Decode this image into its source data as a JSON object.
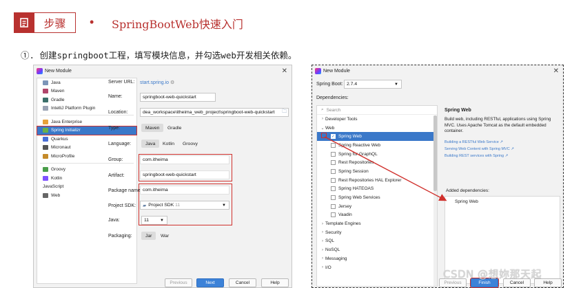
{
  "header": {
    "step_label": "步骤",
    "bullet": "•",
    "title": "SpringBootWeb快速入门",
    "accent_color": "#b8312f"
  },
  "instruction": "①. 创建springboot工程，填写模块信息，并勾选web开发相关依赖。",
  "left_dialog": {
    "title": "New Module",
    "generators": [
      {
        "label": "Java",
        "icon": "folder-icon",
        "color": "#7c95b8"
      },
      {
        "label": "Maven",
        "icon": "maven-icon",
        "color": "#b0466b"
      },
      {
        "label": "Gradle",
        "icon": "gradle-icon",
        "color": "#3b6f6a"
      },
      {
        "label": "IntelliJ Platform Plugin",
        "icon": "plugin-icon",
        "color": "#9aa3b4"
      },
      {
        "label": "Java Enterprise",
        "icon": "enterprise-icon",
        "color": "#e8a13a"
      },
      {
        "label": "Spring Initializr",
        "icon": "spring-icon",
        "color": "#6ab04c",
        "selected": true
      },
      {
        "label": "Quarkus",
        "icon": "quarkus-icon",
        "color": "#4a6fd8"
      },
      {
        "label": "Micronaut",
        "icon": "micronaut-icon",
        "color": "#555555"
      },
      {
        "label": "MicroProfile",
        "icon": "microprofile-icon",
        "color": "#c58b2a"
      },
      {
        "label": "Groovy",
        "icon": "groovy-icon",
        "color": "#4a9e4a"
      },
      {
        "label": "Kotlin",
        "icon": "kotlin-icon",
        "color": "#7f52ff"
      },
      {
        "label": "JavaScript",
        "icon": "",
        "color": ""
      },
      {
        "label": "Web",
        "icon": "globe-icon",
        "color": "#666666"
      }
    ],
    "server_url_label": "Server URL:",
    "server_url": "start.spring.io",
    "name_label": "Name:",
    "name_value": "springboot-web-quickstart",
    "location_label": "Location:",
    "location_value": "dea_workspace\\itheima_web_project\\springboot-web-quickstart",
    "type_label": "Type:",
    "type_options": [
      "Maven",
      "Gradle"
    ],
    "language_label": "Language:",
    "language_options": [
      "Java",
      "Kotlin",
      "Groovy"
    ],
    "group_label": "Group:",
    "group_value": "com.itheima",
    "artifact_label": "Artifact:",
    "artifact_value": "springboot-web-quickstart",
    "package_label": "Package name:",
    "package_value": "com.itheima",
    "sdk_label": "Project SDK:",
    "sdk_value": "Project SDK",
    "sdk_version": "11",
    "java_label": "Java:",
    "java_value": "11",
    "packaging_label": "Packaging:",
    "packaging_options": [
      "Jar",
      "War"
    ],
    "buttons": {
      "previous": "Previous",
      "next": "Next",
      "cancel": "Cancel",
      "help": "Help"
    }
  },
  "right_dialog": {
    "title": "New Module",
    "spring_boot_label": "Spring Boot:",
    "spring_boot_version": "2.7.4",
    "dependencies_label": "Dependencies:",
    "search_placeholder": "Search",
    "tree": [
      {
        "label": "Developer Tools",
        "kind": "group",
        "expanded": false
      },
      {
        "label": "Web",
        "kind": "group",
        "expanded": true
      },
      {
        "label": "Spring Web",
        "kind": "item",
        "checked": true,
        "selected": true
      },
      {
        "label": "Spring Reactive Web",
        "kind": "item",
        "checked": false
      },
      {
        "label": "Spring for GraphQL",
        "kind": "item",
        "checked": false
      },
      {
        "label": "Rest Repositories",
        "kind": "item",
        "checked": false
      },
      {
        "label": "Spring Session",
        "kind": "item",
        "checked": false
      },
      {
        "label": "Rest Repositories HAL Explorer",
        "kind": "item",
        "checked": false
      },
      {
        "label": "Spring HATEOAS",
        "kind": "item",
        "checked": false
      },
      {
        "label": "Spring Web Services",
        "kind": "item",
        "checked": false
      },
      {
        "label": "Jersey",
        "kind": "item",
        "checked": false
      },
      {
        "label": "Vaadin",
        "kind": "item",
        "checked": false
      },
      {
        "label": "Template Engines",
        "kind": "group",
        "expanded": false
      },
      {
        "label": "Security",
        "kind": "group",
        "expanded": false
      },
      {
        "label": "SQL",
        "kind": "group",
        "expanded": false
      },
      {
        "label": "NoSQL",
        "kind": "group",
        "expanded": false
      },
      {
        "label": "Messaging",
        "kind": "group",
        "expanded": false
      },
      {
        "label": "I/O",
        "kind": "group",
        "expanded": false
      }
    ],
    "info_title": "Spring Web",
    "info_desc": "Build web, including RESTful, applications using Spring MVC. Uses Apache Tomcat as the default embedded container.",
    "info_links": [
      "Building a RESTful Web Service ↗",
      "Serving Web Content with Spring MVC ↗",
      "Building REST services with Spring ↗"
    ],
    "added_label": "Added dependencies:",
    "added_items": [
      "Spring Web"
    ],
    "buttons": {
      "previous": "Previous",
      "finish": "Finish",
      "cancel": "Cancel",
      "help": "Help"
    }
  },
  "watermark": "CSDN @想妳那天起"
}
